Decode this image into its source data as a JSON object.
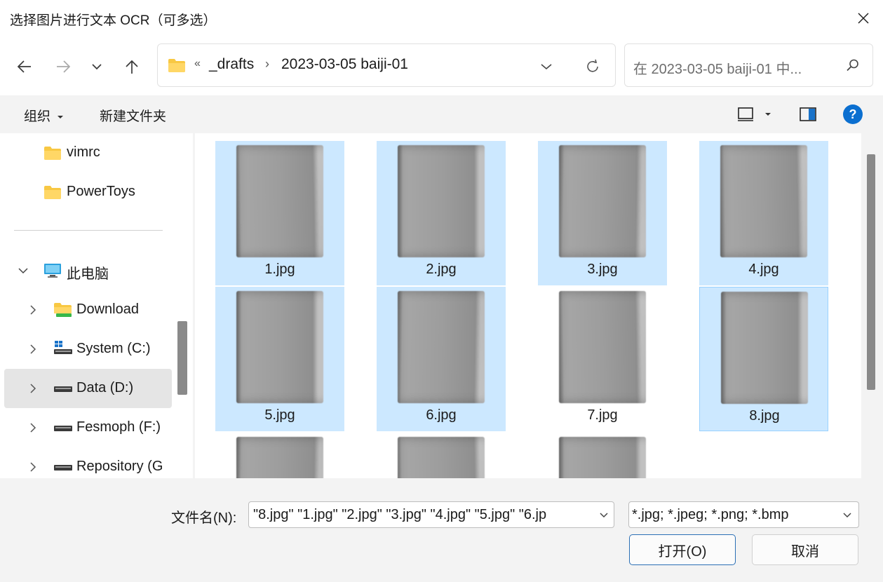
{
  "window": {
    "title": "选择图片进行文本 OCR（可多选）"
  },
  "nav": {
    "breadcrumb_overflow": "«",
    "breadcrumb": [
      "_drafts",
      "2023-03-05 baiji-01"
    ],
    "breadcrumb_separator": "›",
    "search_placeholder": "在 2023-03-05 baiji-01 中..."
  },
  "commands": {
    "organize": "组织",
    "new_folder": "新建文件夹"
  },
  "sidebar": {
    "quick_items": [
      {
        "label": "vimrc"
      },
      {
        "label": "PowerToys"
      }
    ],
    "this_pc": "此电脑",
    "drives": [
      {
        "label": "Download"
      },
      {
        "label": "System (C:)"
      },
      {
        "label": "Data (D:)",
        "selected": true
      },
      {
        "label": "Fesmoph (F:)"
      },
      {
        "label": "Repository (G"
      }
    ]
  },
  "files": [
    {
      "name": "1.jpg",
      "selected": true
    },
    {
      "name": "2.jpg",
      "selected": true
    },
    {
      "name": "3.jpg",
      "selected": true
    },
    {
      "name": "4.jpg",
      "selected": true
    },
    {
      "name": "5.jpg",
      "selected": true
    },
    {
      "name": "6.jpg",
      "selected": true
    },
    {
      "name": "7.jpg",
      "selected": false
    },
    {
      "name": "8.jpg",
      "selected": true,
      "focused": true
    }
  ],
  "footer": {
    "filename_label": "文件名(N):",
    "filename_value": "\"8.jpg\" \"1.jpg\" \"2.jpg\" \"3.jpg\" \"4.jpg\" \"5.jpg\" \"6.jp",
    "filter_value": "*.jpg; *.jpeg; *.png; *.bmp",
    "open_label": "打开(O)",
    "cancel_label": "取消"
  },
  "colors": {
    "accent": "#0067c0",
    "selection": "#cce8ff",
    "folder": "#f8c843"
  }
}
